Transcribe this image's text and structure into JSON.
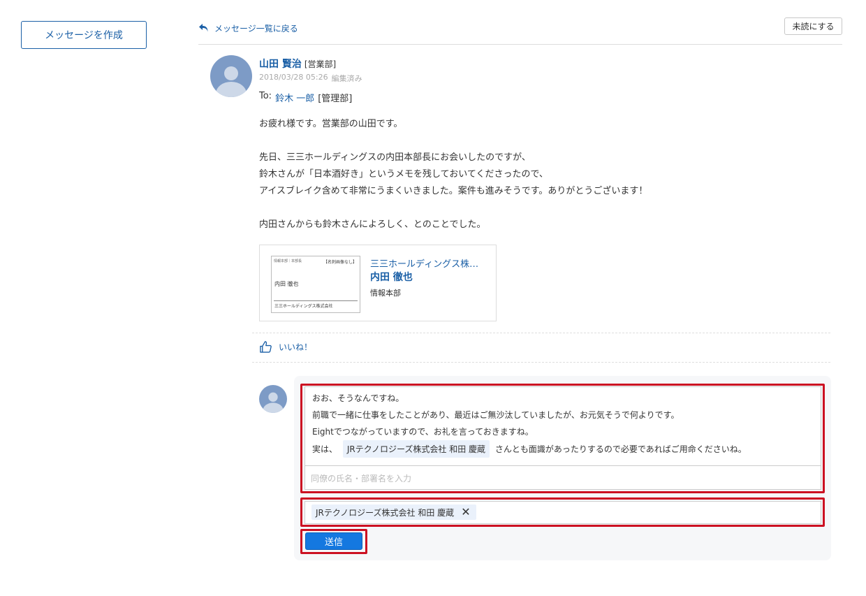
{
  "sidebar": {
    "compose_label": "メッセージを作成"
  },
  "header": {
    "back_label": "メッセージ一覧に戻る",
    "unread_label": "未読にする"
  },
  "message": {
    "sender_name": "山田 賢治",
    "sender_dept": "[営業部]",
    "timestamp": "2018/03/28 05:26",
    "edited_label": "編集済み",
    "to_prefix": "To:",
    "to_name": "鈴木 一郎",
    "to_dept": "[管理部]",
    "body": [
      "お疲れ様です。営業部の山田です。",
      "先日、三三ホールディングスの内田本部長にお会いしたのですが、",
      "鈴木さんが「日本酒好き」というメモを残しておいてくださったので、",
      "アイスブレイク含めて非常にうまくいきました。案件も進みそうです。ありがとうございます！",
      "内田さんからも鈴木さんによろしく、とのことでした。"
    ],
    "card": {
      "thumb_header": "情報本部｜本部長",
      "thumb_no_image": "【名刺画像なし】",
      "thumb_name": "内田 徹也",
      "thumb_company": "三三ホールディングス株式会社",
      "company": "三三ホールディングス株…",
      "person": "内田 徹也",
      "dept": "情報本部"
    },
    "like_label": "いいね！"
  },
  "reply": {
    "lines": [
      "おお、そうなんですね。",
      "前職で一緒に仕事をしたことがあり、最近はご無沙汰していましたが、お元気そうで何よりです。",
      "Eightでつながっていますので、お礼を言っておきますね。"
    ],
    "last_line_prefix": "実は、",
    "mention": "JRテクノロジーズ株式会社 和田 慶蔵",
    "last_line_suffix": "さんとも面識があったりするので必要であればご用命くださいね。",
    "mention_placeholder": "同僚の氏名・部署名を入力",
    "recipient_chip": "JRテクノロジーズ株式会社 和田 慶蔵",
    "chip_close": "✕",
    "send_label": "送信"
  },
  "colors": {
    "link": "#1a5fa6",
    "send_button": "#1478e0",
    "highlight": "#cc1122",
    "chip_bg": "#eaf1fb"
  }
}
